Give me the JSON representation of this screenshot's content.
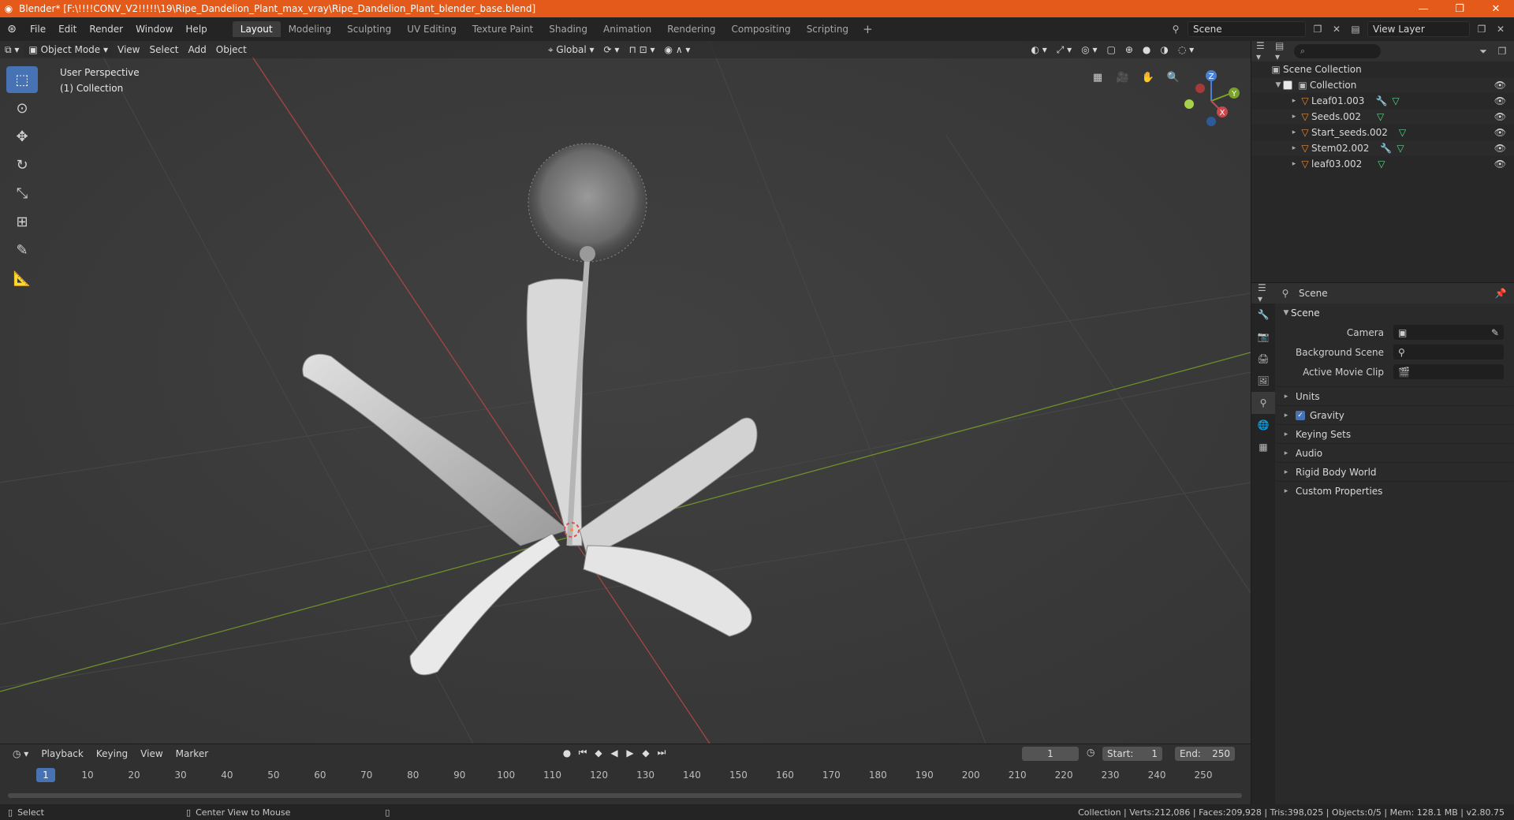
{
  "window": {
    "title": "Blender* [F:\\!!!!CONV_V2!!!!!\\19\\Ripe_Dandelion_Plant_max_vray\\Ripe_Dandelion_Plant_blender_base.blend]",
    "minimize": "—",
    "restore": "❐",
    "close": "✕"
  },
  "menu": [
    "File",
    "Edit",
    "Render",
    "Window",
    "Help"
  ],
  "workspaces": [
    "Layout",
    "Modeling",
    "Sculpting",
    "UV Editing",
    "Texture Paint",
    "Shading",
    "Animation",
    "Rendering",
    "Compositing",
    "Scripting"
  ],
  "workspace_active": "Layout",
  "scene_field": "Scene",
  "view_layer_field": "View Layer",
  "viewport": {
    "mode": "Object Mode",
    "menus": [
      "View",
      "Select",
      "Add",
      "Object"
    ],
    "orientation": "Global",
    "perspective": "User Perspective",
    "collection": "(1) Collection",
    "gizmo": {
      "x": "X",
      "y": "Y",
      "z": "Z"
    }
  },
  "outliner": {
    "search_placeholder": "⌕",
    "scene_collection": "Scene Collection",
    "collection": "Collection",
    "objects": [
      {
        "name": "Leaf01.003",
        "has_modifier": true
      },
      {
        "name": "Seeds.002",
        "has_modifier": false
      },
      {
        "name": "Start_seeds.002",
        "has_modifier": false
      },
      {
        "name": "Stem02.002",
        "has_modifier": true
      },
      {
        "name": "leaf03.002",
        "has_modifier": false
      }
    ]
  },
  "properties": {
    "header": "Scene",
    "panel": "Scene",
    "camera_label": "Camera",
    "background_label": "Background Scene",
    "movie_clip_label": "Active Movie Clip",
    "subpanels": [
      "Units",
      "Gravity",
      "Keying Sets",
      "Audio",
      "Rigid Body World",
      "Custom Properties"
    ]
  },
  "timeline": {
    "menus": [
      "Playback",
      "Keying",
      "View",
      "Marker"
    ],
    "current_frame": "1",
    "start_label": "Start:",
    "start": "1",
    "end_label": "End:",
    "end": "250",
    "ticks": [
      "10",
      "20",
      "30",
      "40",
      "50",
      "60",
      "70",
      "80",
      "90",
      "100",
      "110",
      "120",
      "130",
      "140",
      "150",
      "160",
      "170",
      "180",
      "190",
      "200",
      "210",
      "220",
      "230",
      "240",
      "250"
    ],
    "playhead_label": "1"
  },
  "status": {
    "select": "Select",
    "center": "Center View to Mouse",
    "stats": "Collection | Verts:212,086 | Faces:209,928 | Tris:398,025 | Objects:0/5 | Mem: 128.1 MB | v2.80.75"
  },
  "colors": {
    "titlebar": "#e35a1b",
    "accent": "#4772b3",
    "x_axis": "#c8494b",
    "y_axis": "#7aa12a"
  }
}
